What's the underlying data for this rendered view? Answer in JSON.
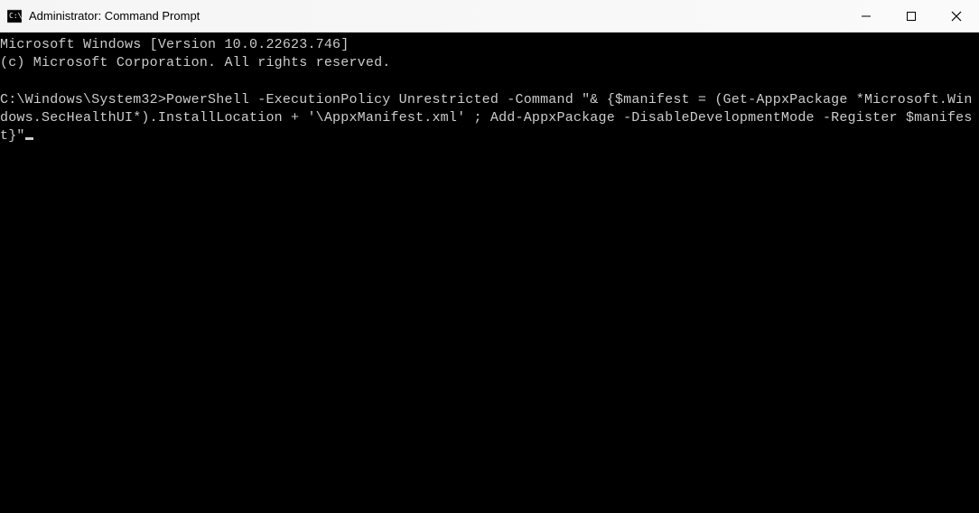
{
  "window": {
    "title": "Administrator: Command Prompt"
  },
  "terminal": {
    "banner_line1": "Microsoft Windows [Version 10.0.22623.746]",
    "banner_line2": "(c) Microsoft Corporation. All rights reserved.",
    "prompt": "C:\\Windows\\System32>",
    "command": "PowerShell -ExecutionPolicy Unrestricted -Command \"& {$manifest = (Get-AppxPackage *Microsoft.Windows.SecHealthUI*).InstallLocation + '\\AppxManifest.xml' ; Add-AppxPackage -DisableDevelopmentMode -Register $manifest}\""
  }
}
